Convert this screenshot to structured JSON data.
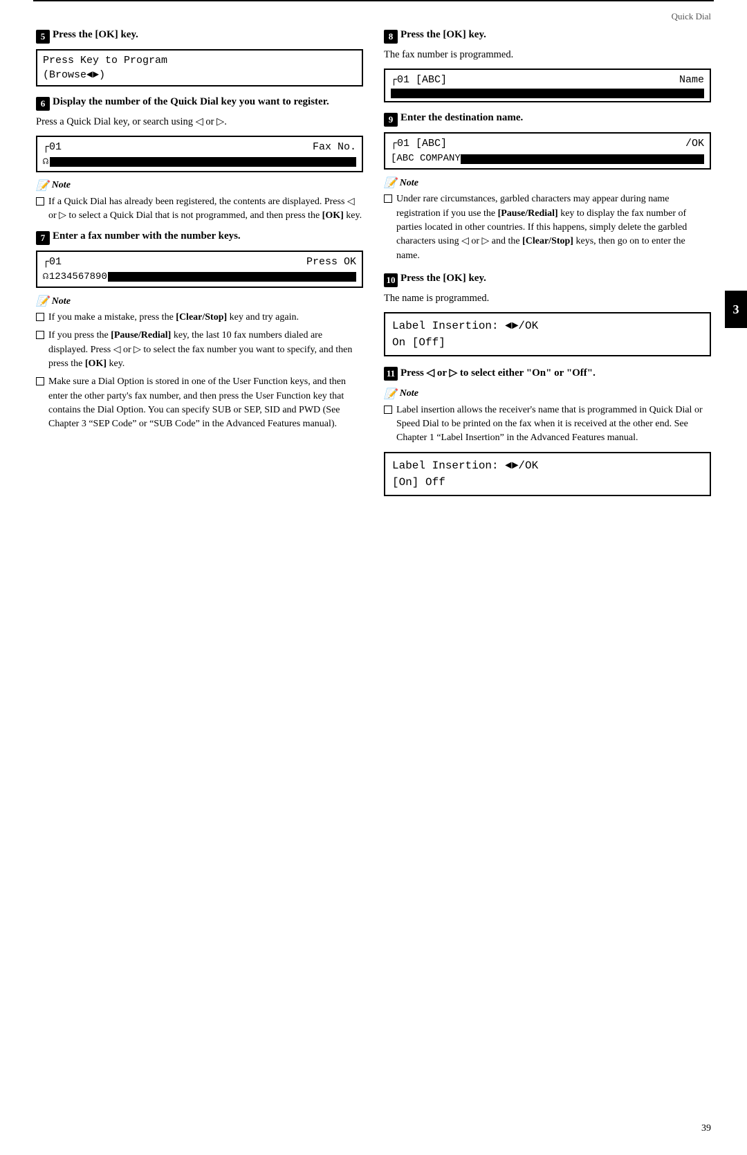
{
  "header": {
    "label": "Quick Dial"
  },
  "page_number": "39",
  "right_tab": "3",
  "steps": {
    "step5": {
      "num": "5",
      "heading": "Press the [OK] key.",
      "lcd": {
        "line1": "Press Key to Program",
        "line2": "          (Browse◄►)"
      }
    },
    "step6": {
      "num": "6",
      "heading": "Display the number of the Quick Dial key you want to register.",
      "body1": "Press a Quick Dial key, or search using ◁ or ▷.",
      "lcd": {
        "line1": "่01",
        "line1_right": "Fax No.",
        "line2_type": "bar"
      },
      "note_heading": "Note",
      "note_item1": "If a Quick Dial has already been registered, the contents are displayed. Press ◁ or ▷ to select a Quick Dial that is not programmed, and then press the [OK] key."
    },
    "step7": {
      "num": "7",
      "heading": "Enter a fax number with the number keys.",
      "lcd": {
        "line1": "่01",
        "line1_right": "Press OK",
        "line2_left": "☊1234567890",
        "line2_type": "bar_partial"
      },
      "note_heading": "Note",
      "note_item1": "If you make a mistake, press the [Clear/Stop] key and try again.",
      "note_item2": "If you press the [Pause/Redial] key, the last 10 fax numbers dialed are displayed. Press ◁ or ▷ to select the fax number you want to specify, and then press the [OK] key.",
      "note_item3": "Make sure a Dial Option is stored in one of the User Function keys, and then enter the other party's fax number, and then press the User Function key that contains the Dial Option. You can specify SUB or SEP, SID and PWD (See Chapter 3 “SEP Code” or “SUB Code” in the Advanced Features manual)."
    },
    "step8": {
      "num": "8",
      "heading": "Press the [OK] key.",
      "body1": "The fax number is programmed.",
      "lcd": {
        "line1_left": "่01 [ABC]",
        "line1_right": "Name",
        "line2_type": "full_bar"
      }
    },
    "step9": {
      "num": "9",
      "heading": "Enter the destination name.",
      "lcd": {
        "line1_left": "่01 [ABC]",
        "line1_right": "/OK",
        "line2_left": "[ABC COMPANY",
        "line2_type": "bar_right"
      },
      "note_heading": "Note",
      "note_item1": "Under rare circumstances, garbled characters may appear during name registration if you use the [Pause/Redial] key to display the fax number of parties located in other countries. If this happens, simply delete the garbled characters using ◁ or ▷ and the [Clear/Stop] keys, then go on to enter the name."
    },
    "step10": {
      "num": "10",
      "heading": "Press the [OK] key.",
      "body1": "The name is programmed.",
      "lcd": {
        "line1": "Label Insertion: ◄►/OK",
        "line2": "On   [Off]"
      }
    },
    "step11": {
      "num": "11",
      "heading": "Press ◁ or ▷ to select either \"On\" or \"Off\".",
      "note_heading": "Note",
      "note_item1": "Label insertion allows the receiver's name that is programmed in Quick Dial or Speed Dial to be printed on the fax when it is received at the other end. See Chapter 1 “Label Insertion” in the Advanced Features manual.",
      "lcd2": {
        "line1": "Label Insertion: ◄►/OK",
        "line2": "[On]  Off"
      }
    }
  }
}
